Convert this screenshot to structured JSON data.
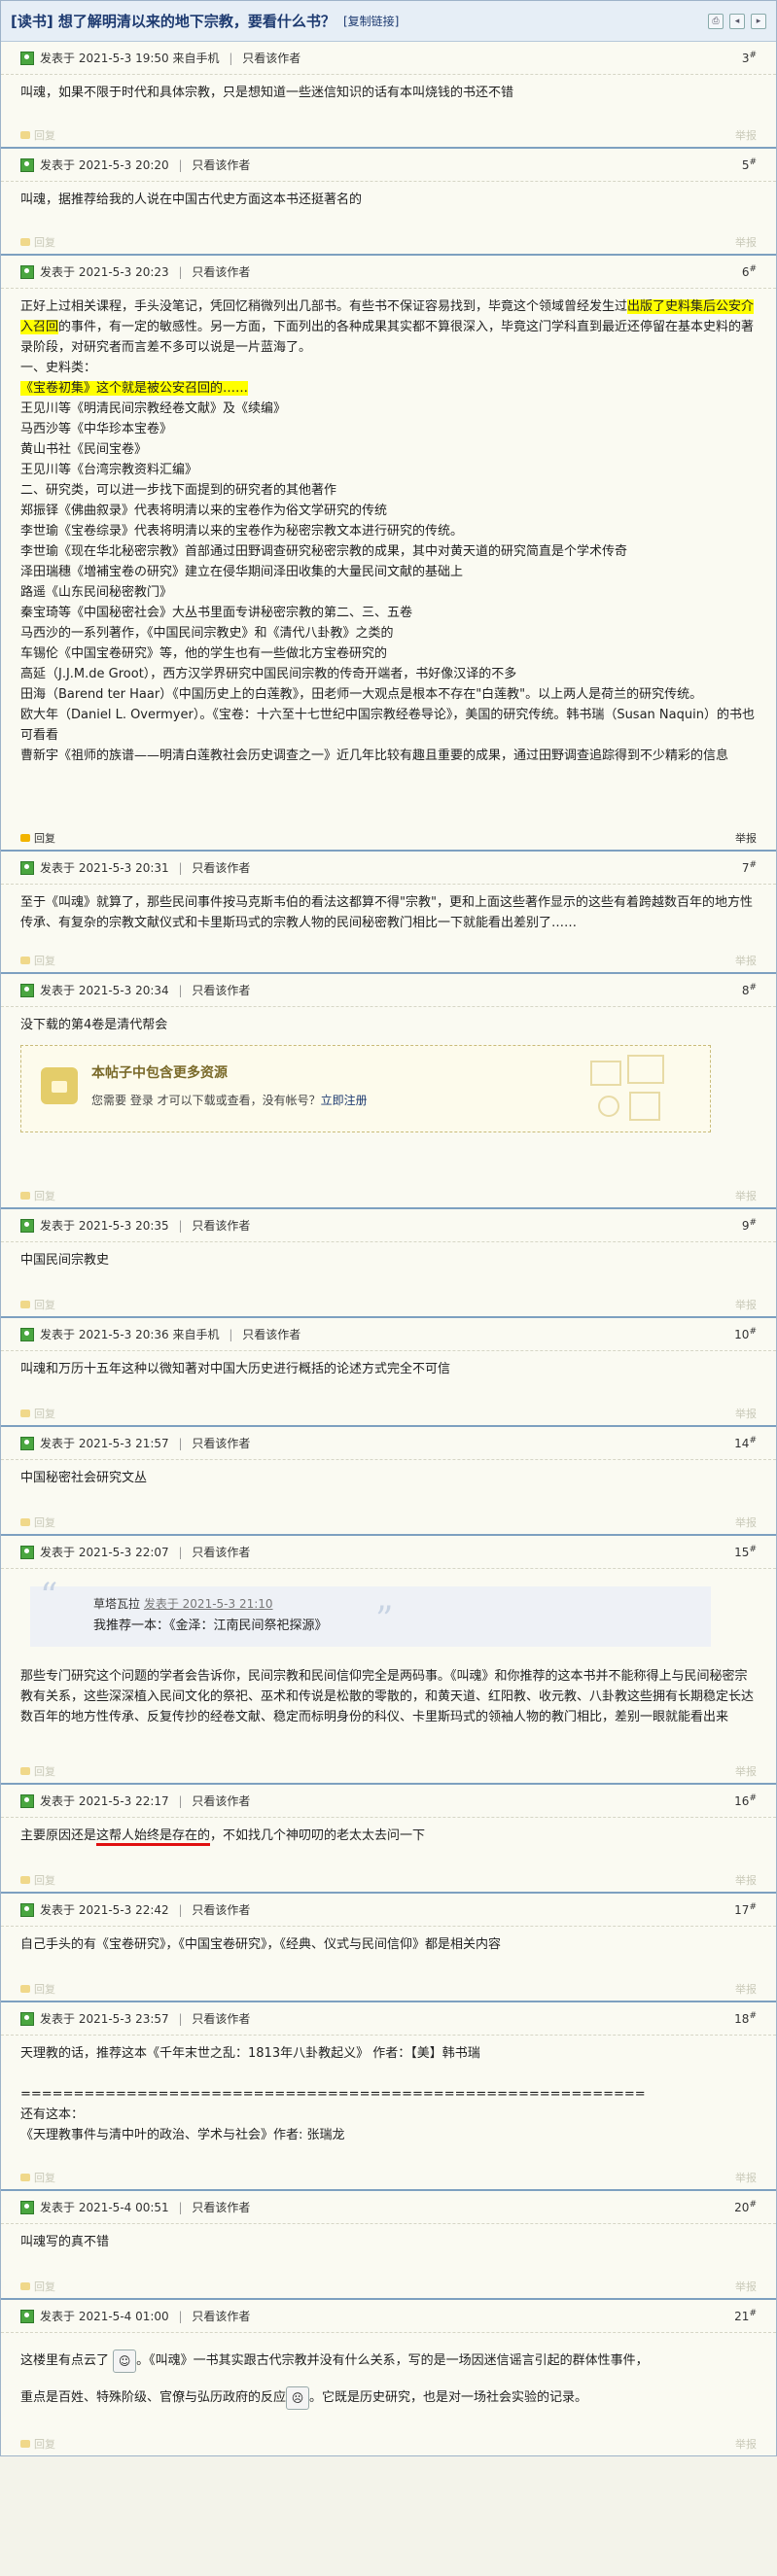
{
  "thread": {
    "title": "[读书] 想了解明清以来的地下宗教，要看什么书？",
    "copy_link": "[复制链接]"
  },
  "common": {
    "only_author": "只看该作者",
    "reply": "回复",
    "report": "举报",
    "floor_mark": "#"
  },
  "posts": [
    {
      "time": "发表于 2021-5-3 19:50",
      "source": "来自手机",
      "floor": "3",
      "lines": [
        "叫魂，如果不限于时代和具体宗教，只是想知道一些迷信知识的话有本叫烧钱的书还不错"
      ]
    },
    {
      "time": "发表于 2021-5-3 20:20",
      "floor": "5",
      "lines": [
        "叫魂，据推荐给我的人说在中国古代史方面这本书还挺著名的"
      ]
    },
    {
      "time": "发表于 2021-5-3 20:23",
      "floor": "6",
      "p1a": "正好上过相关课程，手头没笔记，凭回忆稍微列出几部书。有些书不保证容易找到，毕竟这个领域曾经发生过",
      "p1hl": "出版了史料集后公安介入召回",
      "p1b": "的事件，有一定的敏感性。另一方面，下面列出的各种成果其实都不算很深入，毕竟这门学科直到最近还停留在基本史料的著录阶段，对研究者而言差不多可以说是一片蓝海了。",
      "l_sec1": "一、史料类：",
      "l_hl2": "《宝卷初集》这个就是被公安召回的……",
      "lines1": [
        "王见川等《明清民间宗教经卷文献》及《续编》",
        "马西沙等《中华珍本宝卷》",
        "黄山书社《民间宝卷》",
        "王见川等《台湾宗教资料汇编》",
        "二、研究类，可以进一步找下面提到的研究者的其他著作",
        "郑振铎《佛曲叙录》代表将明清以来的宝卷作为俗文学研究的传统",
        "李世瑜《宝卷综录》代表将明清以来的宝卷作为秘密宗教文本进行研究的传统。",
        "李世瑜《现在华北秘密宗教》首部通过田野调查研究秘密宗教的成果，其中对黄天道的研究简直是个学术传奇",
        "泽田瑞穗《増補宝卷の研究》建立在侵华期间泽田收集的大量民间文献的基础上",
        "路遥《山东民间秘密教门》",
        "秦宝琦等《中国秘密社会》大丛书里面专讲秘密宗教的第二、三、五卷",
        "马西沙的一系列著作，《中国民间宗教史》和《清代八卦教》之类的",
        "车锡伦《中国宝卷研究》等，他的学生也有一些做北方宝卷研究的",
        "高延（J.J.M.de Groot），西方汉学界研究中国民间宗教的传奇开端者，书好像汉译的不多",
        "田海（Barend ter Haar）《中国历史上的白莲教》，田老师一大观点是根本不存在\"白莲教\"。以上两人是荷兰的研究传统。",
        "欧大年（Daniel L. Overmyer）。《宝卷：十六至十七世纪中国宗教经卷导论》，美国的研究传统。韩书瑞（Susan Naquin）的书也可看看",
        "曹新宇《祖师的族谱——明清白莲教社会历史调查之一》近几年比较有趣且重要的成果，通过田野调查追踪得到不少精彩的信息"
      ]
    },
    {
      "time": "发表于 2021-5-3 20:31",
      "floor": "7",
      "lines": [
        "至于《叫魂》就算了，那些民间事件按马克斯韦伯的看法这都算不得\"宗教\"，更和上面这些著作显示的这些有着跨越数百年的地方性传承、有复杂的宗教文献仪式和卡里斯玛式的宗教人物的民间秘密教门相比一下就能看出差别了……"
      ]
    },
    {
      "time": "发表于 2021-5-3 20:34",
      "floor": "8",
      "lines": [
        "没下载的第4卷是清代帮会"
      ],
      "hide_title": "本帖子中包含更多资源",
      "hide_text": "您需要 登录 才可以下载或查看，没有帐号？",
      "hide_link": "立即注册"
    },
    {
      "time": "发表于 2021-5-3 20:35",
      "floor": "9",
      "lines": [
        "中国民间宗教史"
      ]
    },
    {
      "time": "发表于 2021-5-3 20:36",
      "source": "来自手机",
      "floor": "10",
      "lines": [
        "叫魂和万历十五年这种以微知著对中国大历史进行概括的论述方式完全不可信"
      ]
    },
    {
      "time": "发表于 2021-5-3 21:57",
      "floor": "14",
      "lines": [
        "中国秘密社会研究文丛"
      ]
    },
    {
      "time": "发表于 2021-5-3 22:07",
      "floor": "15",
      "quote_author": "草塔瓦拉",
      "quote_time": "发表于 2021-5-3 21:10",
      "quote_text": "我推荐一本：《金泽：江南民间祭祀探源》",
      "lines": [
        "那些专门研究这个问题的学者会告诉你，民间宗教和民间信仰完全是两码事。《叫魂》和你推荐的这本书并不能称得上与民间秘密宗教有关系，这些深深植入民间文化的祭祀、巫术和传说是松散的零散的，和黄天道、红阳教、收元教、八卦教这些拥有长期稳定长达数百年的地方性传承、反复传抄的经卷文献、稳定而标明身份的科仪、卡里斯玛式的领袖人物的教门相比，差别一眼就能看出来"
      ]
    },
    {
      "time": "发表于 2021-5-3 22:17",
      "floor": "16",
      "pre": "主要原因还是",
      "underlined": "这帮人始终是存在的",
      "post": "，不如找几个神叨叨的老太太去问一下"
    },
    {
      "time": "发表于 2021-5-3 22:42",
      "floor": "17",
      "lines": [
        "自己手头的有《宝卷研究》，《中国宝卷研究》，《经典、仪式与民间信仰》都是相关内容"
      ]
    },
    {
      "time": "发表于 2021-5-3 23:57",
      "floor": "18",
      "lines": [
        "天理教的话，推荐这本《千年末世之乱：1813年八卦教起义》  作者：【美】韩书瑞",
        "",
        "===========================================================",
        "还有这本：",
        "《天理教事件与清中叶的政治、学术与社会》作者: 张瑞龙"
      ]
    },
    {
      "time": "发表于 2021-5-4 00:51",
      "floor": "20",
      "lines": [
        "叫魂写的真不错"
      ]
    },
    {
      "time": "发表于 2021-5-4 01:00",
      "floor": "21",
      "l1a": "这楼里有点云了",
      "l1b": "。《叫魂》一书其实跟古代宗教并没有什么关系，写的是一场因迷信谣言引起的群体性事件，",
      "l2a": "重点是百姓、特殊阶级、官僚与弘历政府的反应",
      "l2b": "。它既是历史研究，也是对一场社会实验的记录。"
    }
  ]
}
